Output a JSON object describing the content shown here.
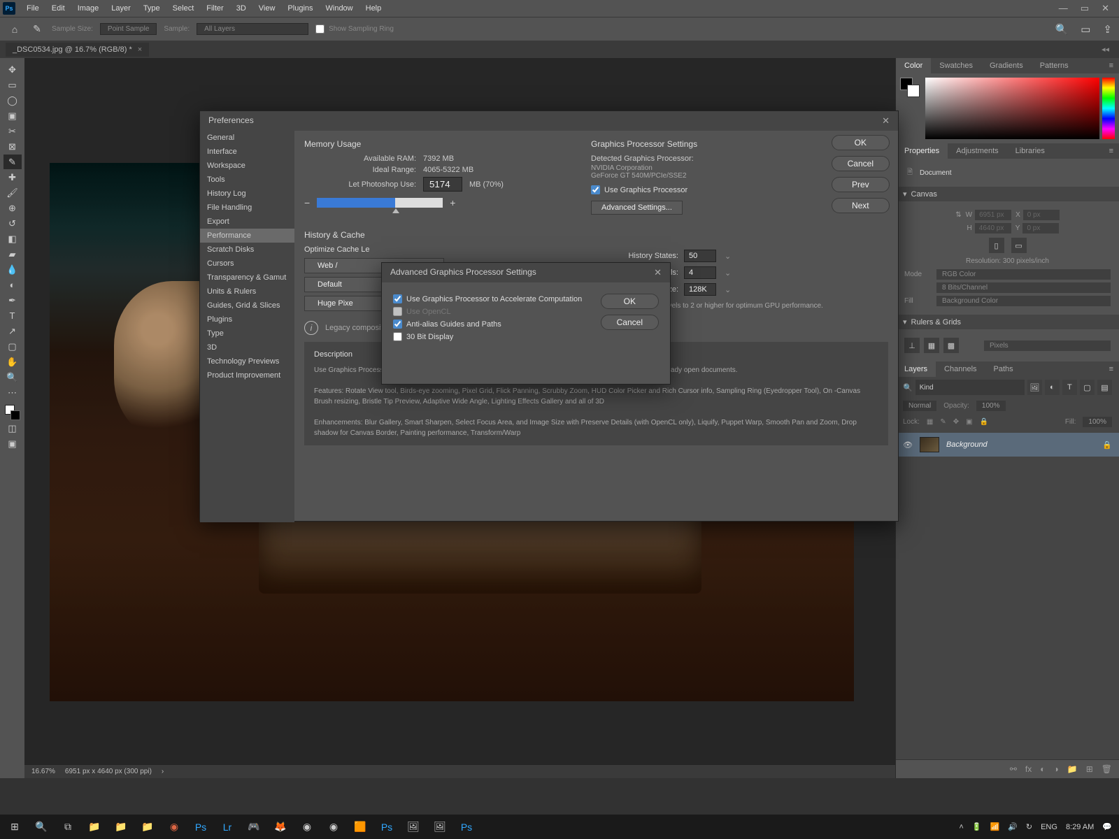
{
  "menu": {
    "items": [
      "File",
      "Edit",
      "Image",
      "Layer",
      "Type",
      "Select",
      "Filter",
      "3D",
      "View",
      "Plugins",
      "Window",
      "Help"
    ]
  },
  "options": {
    "sample_size_label": "Sample Size:",
    "sample_size_value": "Point Sample",
    "sample_label": "Sample:",
    "sample_value": "All Layers",
    "show_sampling_ring": "Show Sampling Ring"
  },
  "doctab": {
    "name": "_DSC0534.jpg @ 16.7% (RGB/8) *"
  },
  "status": {
    "zoom": "16.67%",
    "info": "6951 px x 4640 px (300 ppi)"
  },
  "right": {
    "colorTabs": [
      "Color",
      "Swatches",
      "Gradients",
      "Patterns"
    ],
    "propTabs": [
      "Properties",
      "Adjustments",
      "Libraries"
    ],
    "docLabel": "Document",
    "canvasLabel": "Canvas",
    "w_label": "W",
    "h_label": "H",
    "x_label": "X",
    "y_label": "Y",
    "w": "6951 px",
    "h": "4640 px",
    "x": "0 px",
    "y": "0 px",
    "resolution": "Resolution: 300 pixels/inch",
    "modeLabel": "Mode",
    "mode": "RGB Color",
    "bits": "8 Bits/Channel",
    "fillLabel": "Fill",
    "fill": "Background Color",
    "rulersLabel": "Rulers & Grids",
    "rulerUnit": "Pixels",
    "layerTabs": [
      "Layers",
      "Channels",
      "Paths"
    ],
    "kindLabel": "Kind",
    "blend": "Normal",
    "opacityLabel": "Opacity:",
    "opacity": "100%",
    "lockLabel": "Lock:",
    "fillPctLabel": "Fill:",
    "fillPct": "100%",
    "layerName": "Background"
  },
  "prefs": {
    "title": "Preferences",
    "nav": [
      "General",
      "Interface",
      "Workspace",
      "Tools",
      "History Log",
      "File Handling",
      "Export",
      "Performance",
      "Scratch Disks",
      "Cursors",
      "Transparency & Gamut",
      "Units & Rulers",
      "Guides, Grid & Slices",
      "Plugins",
      "Type",
      "3D",
      "Technology Previews",
      "Product Improvement"
    ],
    "active": "Performance",
    "buttons": {
      "ok": "OK",
      "cancel": "Cancel",
      "prev": "Prev",
      "next": "Next"
    },
    "memory": {
      "title": "Memory Usage",
      "available_label": "Available RAM:",
      "available": "7392 MB",
      "ideal_label": "Ideal Range:",
      "ideal": "4065-5322 MB",
      "let_label": "Let Photoshop Use:",
      "let_value": "5174",
      "let_suffix": "MB (70%)"
    },
    "gpu": {
      "title": "Graphics Processor Settings",
      "detected_label": "Detected Graphics Processor:",
      "vendor": "NVIDIA Corporation",
      "device": "GeForce GT 540M/PCIe/SSE2",
      "use_gp": "Use Graphics Processor",
      "advanced_btn": "Advanced Settings..."
    },
    "history": {
      "title": "History & Cache",
      "optimize": "Optimize Cache Le",
      "btns": {
        "web": "Web / ",
        "def": "Default",
        "huge": "Huge Pixe"
      },
      "states_label": "History States:",
      "states": "50",
      "levels_label": "Cache Levels:",
      "levels": "4",
      "tile_label": "Cache Tile Size:",
      "tile": "128K",
      "note": "Set Cache Levels to 2 or higher for optimum GPU performance."
    },
    "legacy": "Legacy composit",
    "desc": {
      "title": "Description",
      "p1": "Use Graphics Processor activates certain features and interface enhancements. It does not enable OpenGL on already open documents.",
      "p2": "Features: Rotate View tool, Birds-eye zooming, Pixel Grid, Flick Panning, Scrubby Zoom, HUD Color Picker and Rich Cursor info, Sampling Ring (Eyedropper Tool), On -Canvas Brush resizing, Bristle Tip Preview, Adaptive Wide Angle, Lighting Effects Gallery and all of 3D",
      "p3": "Enhancements: Blur Gallery, Smart Sharpen, Select Focus Area, and Image Size with Preserve Details (with OpenCL only), Liquify, Puppet Warp, Smooth Pan and Zoom, Drop shadow for Canvas Border, Painting performance, Transform/Warp"
    }
  },
  "adv": {
    "title": "Advanced Graphics Processor Settings",
    "opts": {
      "accel": "Use Graphics Processor to Accelerate Computation",
      "opencl": "Use OpenCL",
      "antialias": "Anti-alias Guides and Paths",
      "bit30": "30 Bit Display"
    },
    "ok": "OK",
    "cancel": "Cancel"
  },
  "taskbar": {
    "lang": "ENG",
    "time": "8:29 AM"
  }
}
